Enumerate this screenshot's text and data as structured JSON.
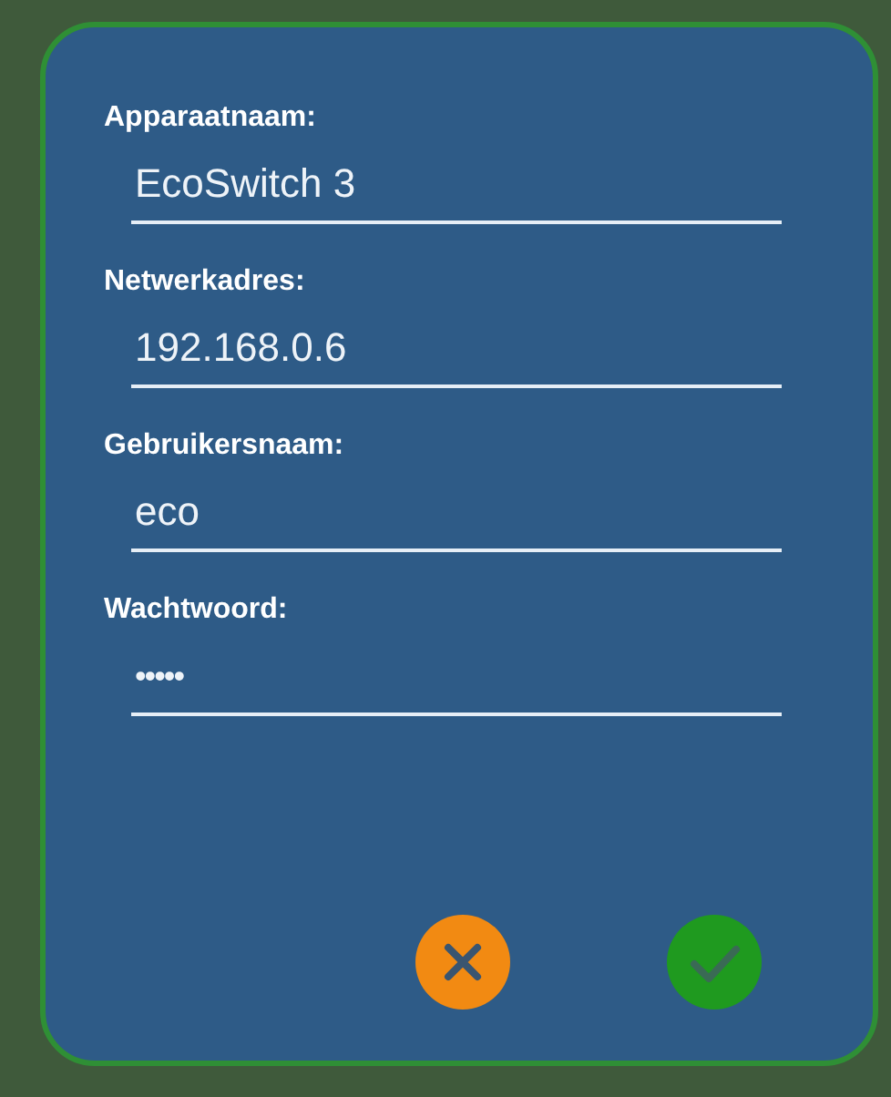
{
  "dialog": {
    "fields": [
      {
        "label": "Apparaatnaam:",
        "value": "EcoSwitch 3",
        "kind": "text"
      },
      {
        "label": "Netwerkadres:",
        "value": "192.168.0.6",
        "kind": "text"
      },
      {
        "label": "Gebruikersnaam:",
        "value": "eco",
        "kind": "text"
      },
      {
        "label": "Wachtwoord:",
        "value": "•••••",
        "kind": "password"
      }
    ],
    "buttons": [
      {
        "kind": "cancel"
      },
      {
        "kind": "confirm"
      }
    ]
  }
}
